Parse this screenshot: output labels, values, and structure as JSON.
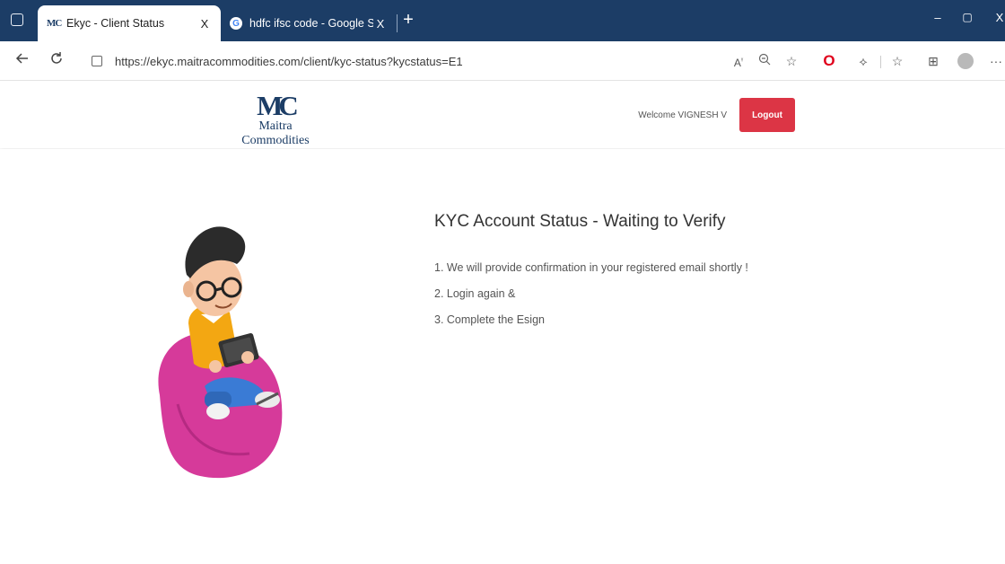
{
  "browser": {
    "tabs": [
      {
        "title": "Ekyc - Client Status",
        "favicon": "MC",
        "active": true
      },
      {
        "title": "hdfc ifsc code - Google Search",
        "favicon": "G",
        "active": false
      }
    ],
    "tab_close_glyph": "X",
    "new_tab_glyph": "+",
    "window_controls": {
      "minimize": "–",
      "restore": "▢",
      "close": "X"
    },
    "url": "https://ekyc.maitracommodities.com/client/kyc-status?kycstatus=E1",
    "toolbar_icons": [
      "read-aloud-icon",
      "zoom-icon",
      "favorites-icon",
      "opera-icon",
      "extensions-icon",
      "favorites-bar-icon",
      "collections-icon",
      "profile-icon",
      "more-icon"
    ],
    "colors": {
      "tabbar": "#1c3d66",
      "opera": "#e0001b"
    }
  },
  "header": {
    "logo_mark": "MC",
    "logo_name": "Maitra Commodities",
    "welcome_text": "Welcome VIGNESH V",
    "logout_label": "Logout",
    "colors": {
      "logout": "#dc3545",
      "brand": "#1c3d66"
    }
  },
  "main": {
    "title": "KYC Account Status - Waiting to Verify",
    "steps": [
      "1. We will provide confirmation in your registered email shortly !",
      "2. Login again &",
      "3. Complete the Esign"
    ],
    "illustration": "person-on-beanbag-with-tablet"
  }
}
